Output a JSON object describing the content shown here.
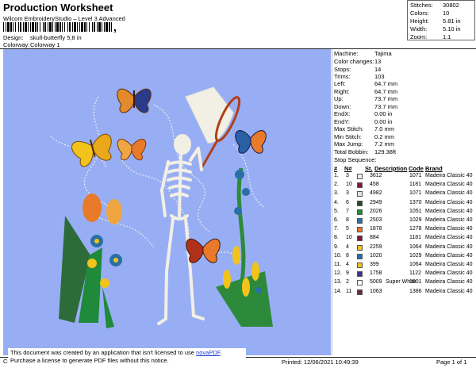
{
  "header": {
    "title": "Production Worksheet",
    "subtitle": "Wilcom EmbroideryStudio – Level 3 Advanced",
    "barcode_suffix": ",",
    "design_label": "Design:",
    "design_value": "skull-butterfly 5,8 in",
    "colorway_label": "Colorway:",
    "colorway_value": "Colorway 1"
  },
  "stats": [
    {
      "label": "Stitches:",
      "value": "30802"
    },
    {
      "label": "Colors:",
      "value": "10"
    },
    {
      "label": "Height:",
      "value": "5.81 in"
    },
    {
      "label": "Width:",
      "value": "5.10 in"
    },
    {
      "label": "Zoom:",
      "value": "1:1"
    }
  ],
  "machine": [
    {
      "label": "Machine:",
      "value": "Tajima"
    },
    {
      "label": "Color changes:",
      "value": "13"
    },
    {
      "label": "Stops:",
      "value": "14"
    },
    {
      "label": "Trims:",
      "value": "103"
    },
    {
      "label": "Left:",
      "value": "64.7 mm"
    },
    {
      "label": "Right:",
      "value": "64.7 mm"
    },
    {
      "label": "Up:",
      "value": "73.7 mm"
    },
    {
      "label": "Down:",
      "value": "73.7 mm"
    },
    {
      "label": "EndX:",
      "value": "0.00 in"
    },
    {
      "label": "EndY:",
      "value": "0.00 in"
    },
    {
      "label": "Max Stitch:",
      "value": "7.0 mm"
    },
    {
      "label": "Min Stitch:",
      "value": "0.2 mm"
    },
    {
      "label": "Max Jump:",
      "value": "7.2 mm"
    },
    {
      "label": "Total Bobbin:",
      "value": "129.38ft"
    }
  ],
  "sequence": {
    "title": "Stop Sequence:",
    "headers": {
      "num": "#",
      "n": "N#",
      "st": "St.",
      "desc": "Description",
      "code": "Code",
      "brand": "Brand"
    },
    "rows": [
      {
        "num": "1.",
        "n": "3",
        "color": "#efeee6",
        "st": "3612",
        "desc": "",
        "code": "1071",
        "brand": "Madeira Classic 40"
      },
      {
        "num": "2.",
        "n": "10",
        "color": "#7c1c2e",
        "st": "458",
        "desc": "",
        "code": "1181",
        "brand": "Madeira Classic 40"
      },
      {
        "num": "3.",
        "n": "3",
        "color": "#e8e6dc",
        "st": "4982",
        "desc": "",
        "code": "1071",
        "brand": "Madeira Classic 40"
      },
      {
        "num": "4.",
        "n": "6",
        "color": "#244a2c",
        "st": "2949",
        "desc": "",
        "code": "1370",
        "brand": "Madeira Classic 40"
      },
      {
        "num": "5.",
        "n": "7",
        "color": "#1f8a3a",
        "st": "2026",
        "desc": "",
        "code": "1051",
        "brand": "Madeira Classic 40"
      },
      {
        "num": "6.",
        "n": "8",
        "color": "#2a6fa6",
        "st": "2503",
        "desc": "",
        "code": "1029",
        "brand": "Madeira Classic 40"
      },
      {
        "num": "7.",
        "n": "5",
        "color": "#e9752a",
        "st": "1878",
        "desc": "",
        "code": "1278",
        "brand": "Madeira Classic 40"
      },
      {
        "num": "8.",
        "n": "10",
        "color": "#7a1a2c",
        "st": "884",
        "desc": "",
        "code": "1181",
        "brand": "Madeira Classic 40"
      },
      {
        "num": "9.",
        "n": "4",
        "color": "#f2c31a",
        "st": "2259",
        "desc": "",
        "code": "1064",
        "brand": "Madeira Classic 40"
      },
      {
        "num": "10.",
        "n": "8",
        "color": "#2a6fa6",
        "st": "1020",
        "desc": "",
        "code": "1029",
        "brand": "Madeira Classic 40"
      },
      {
        "num": "11.",
        "n": "4",
        "color": "#f2c31a",
        "st": "399",
        "desc": "",
        "code": "1064",
        "brand": "Madeira Classic 40"
      },
      {
        "num": "12.",
        "n": "9",
        "color": "#3a3490",
        "st": "1758",
        "desc": "",
        "code": "1122",
        "brand": "Madeira Classic 40"
      },
      {
        "num": "13.",
        "n": "2",
        "color": "#ffffff",
        "st": "5009",
        "desc": "Super White",
        "code": "1001",
        "brand": "Madeira Classic 40"
      },
      {
        "num": "14.",
        "n": "11",
        "color": "#6a2c3a",
        "st": "1063",
        "desc": "",
        "code": "1386",
        "brand": "Madeira Classic 40"
      }
    ]
  },
  "footer": {
    "cr": "Cr",
    "notice_line1": "This document was created by an application that isn't licensed to use ",
    "notice_link": "novaPDF",
    "notice_line1_end": ".",
    "notice_line2": "Purchase a license to generate PDF files without this notice.",
    "printed": "Printed:  12/06/2021 10:49:39",
    "page": "Page 1 of 1"
  },
  "colors": {
    "design_bg": "#98aef4",
    "link": "#1a3fd0"
  }
}
